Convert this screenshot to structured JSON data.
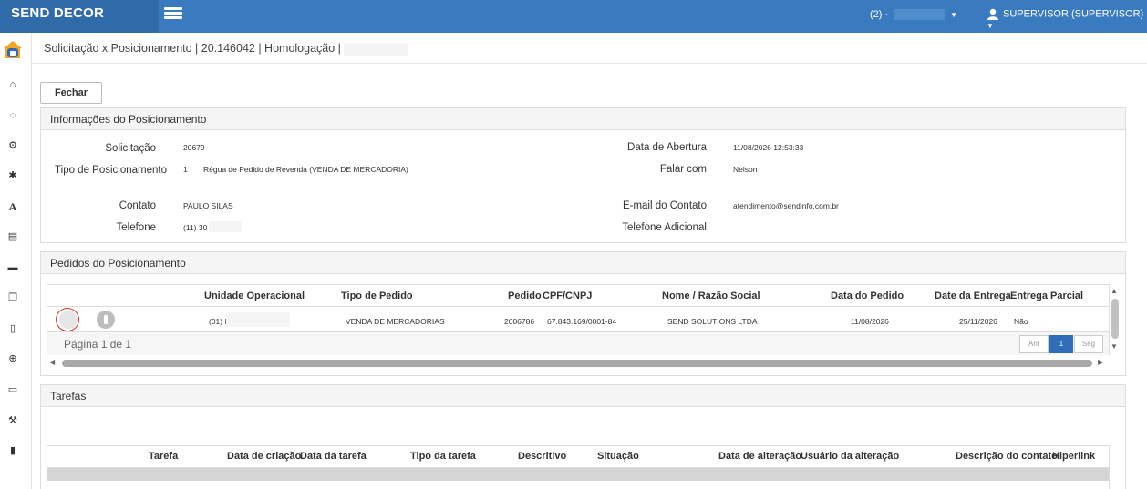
{
  "header": {
    "brand": "SEND DECOR",
    "company_prefix": "(2) -",
    "user": "SUPERVISOR (SUPERVISOR)"
  },
  "sidebar": {
    "icons": [
      "home-icon",
      "spinner-icon",
      "cogs-icon",
      "gear-icon",
      "font-icon",
      "list-icon",
      "car-icon",
      "copy-icon",
      "file-icon",
      "globe-icon",
      "laptop-icon",
      "wrench-icon",
      "document-icon"
    ]
  },
  "breadcrumb": "Solicitação x Posicionamento | 20.146042 | Homologação |",
  "toolbar": {
    "close_label": "Fechar"
  },
  "info": {
    "title": "Informações do Posicionamento",
    "solicitacao_label": "Solicitação",
    "solicitacao_value": "20679",
    "tipo_label": "Tipo de Posicionamento",
    "tipo_code": "1",
    "tipo_value": "Régua de Pedido de Revenda (VENDA DE MERCADORIA)",
    "contato_label": "Contato",
    "contato_value": "PAULO SILAS",
    "telefone_label": "Telefone",
    "telefone_value": "(11) 30",
    "abertura_label": "Data de Abertura",
    "abertura_value": "11/08/2026 12:53:33",
    "falar_label": "Falar com",
    "falar_value": "Nelson",
    "email_label": "E-mail do Contato",
    "email_value": "atendimento@sendinfo.com.br",
    "tel_adicional_label": "Telefone Adicional"
  },
  "pedidos": {
    "title": "Pedidos do Posicionamento",
    "columns": {
      "unidade": "Unidade Operacional",
      "tipo": "Tipo de Pedido",
      "pedido": "Pedido",
      "cpf": "CPF/CNPJ",
      "nome": "Nome / Razão Social",
      "data": "Data do Pedido",
      "entrega": "Date da Entrega",
      "parcial": "Entrega Parcial"
    },
    "row": {
      "unidade": "(01) I",
      "tipo": "VENDA DE MERCADORIAS",
      "pedido": "2006786",
      "cpf": "67.843.169/0001-84",
      "nome": "SEND SOLUTIONS LTDA",
      "data": "11/08/2026",
      "entrega": "25/11/2026",
      "parcial": "Não"
    },
    "page_info": "Página 1 de 1",
    "prev": "Ant",
    "page": "1",
    "next": "Seg"
  },
  "tarefas": {
    "title": "Tarefas",
    "columns": {
      "tarefa": "Tarefa",
      "criacao": "Data de criação",
      "data_tarefa": "Data da tarefa",
      "tipo": "Tipo da tarefa",
      "descritivo": "Descritivo",
      "situacao": "Situação",
      "alteracao": "Data de alteração",
      "usuario": "Usuário da alteração",
      "descricao": "Descrição do contato",
      "hiperlink": "Hiperlink"
    }
  }
}
